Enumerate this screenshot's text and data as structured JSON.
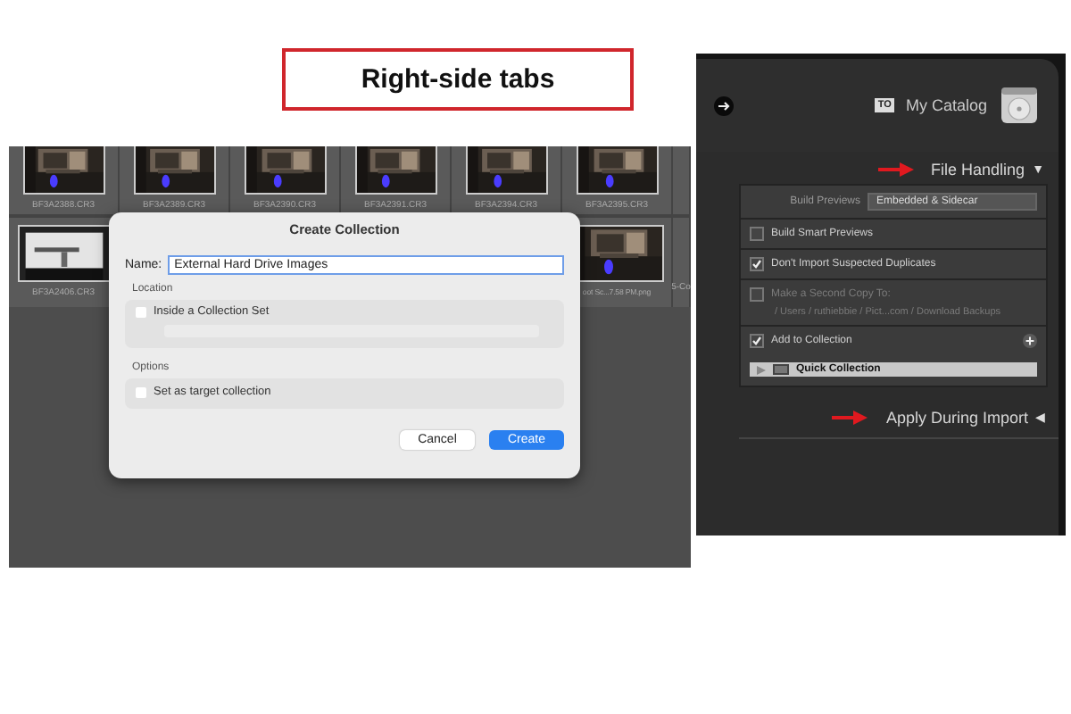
{
  "annotation": {
    "title": "Right-side tabs"
  },
  "library": {
    "top_row": [
      {
        "caption": "BF3A2388.CR3"
      },
      {
        "caption": "BF3A2389.CR3"
      },
      {
        "caption": "BF3A2390.CR3"
      },
      {
        "caption": "BF3A2391.CR3"
      },
      {
        "caption": "BF3A2394.CR3"
      },
      {
        "caption": "BF3A2395.CR3"
      }
    ],
    "second_row": {
      "left": {
        "caption": "BF3A2406.CR3"
      },
      "right": {
        "caption": "oot Sc...7.58 PM.png"
      },
      "edge": {
        "caption": "5-Co"
      }
    }
  },
  "dialog": {
    "title": "Create Collection",
    "name_label": "Name:",
    "name_value": "External Hard Drive Images",
    "location_label": "Location",
    "inside_set": {
      "label": "Inside a Collection Set",
      "checked": false
    },
    "options_label": "Options",
    "target": {
      "label": "Set as target collection",
      "checked": false
    },
    "buttons": [
      {
        "label": "Cancel",
        "kind": "secondary"
      },
      {
        "label": "Create",
        "kind": "primary"
      }
    ]
  },
  "catalog": {
    "badge": "TO",
    "title": "My Catalog",
    "file_handling": {
      "title": "File Handling",
      "marker": "▼",
      "build_previews": {
        "label": "Build Previews",
        "value": "Embedded & Sidecar"
      },
      "options": [
        {
          "label": "Build Smart Previews",
          "checked": false,
          "disabled": false
        },
        {
          "label": "Don't Import Suspected Duplicates",
          "checked": true,
          "disabled": false
        },
        {
          "label": "Make a Second Copy To:",
          "checked": false,
          "disabled": true,
          "path": "/ Users / ruthiebbie / Pict...com / Download Backups"
        }
      ]
    },
    "collection": {
      "label": "Add to Collection",
      "checked": true,
      "item": "Quick Collection"
    },
    "apply": {
      "title": "Apply During Import",
      "marker": "◀"
    }
  }
}
